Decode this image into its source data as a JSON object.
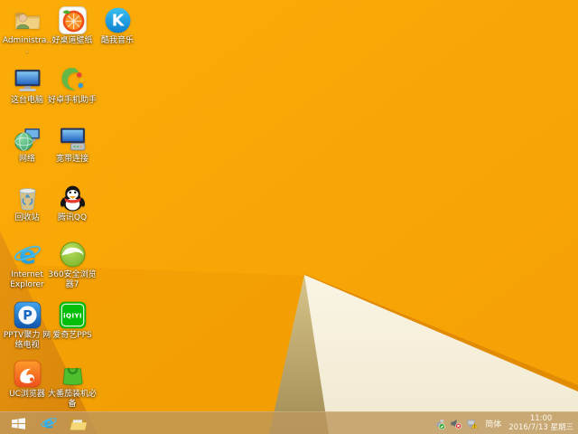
{
  "desktop": {
    "icons": [
      {
        "id": "administrator",
        "label": "Administra...",
        "icon": "user-folder-icon"
      },
      {
        "id": "haozhuodao-wallpaper",
        "label": "好桌道壁纸",
        "icon": "orange-slice-icon"
      },
      {
        "id": "kuwo-music",
        "label": "酷我音乐",
        "icon": "kuwo-k-icon",
        "glyph": "K"
      },
      {
        "id": "this-pc",
        "label": "这台电脑",
        "icon": "computer-icon"
      },
      {
        "id": "haozhuo-phone-assistant",
        "label": "好卓手机助手",
        "icon": "green-swirl-icon"
      },
      {
        "id": "network",
        "label": "网络",
        "icon": "network-globe-icon"
      },
      {
        "id": "broadband-connection",
        "label": "宽带连接",
        "icon": "broadband-icon"
      },
      {
        "id": "recycle-bin",
        "label": "回收站",
        "icon": "recycle-bin-icon"
      },
      {
        "id": "tencent-qq",
        "label": "腾讯QQ",
        "icon": "qq-penguin-icon"
      },
      {
        "id": "internet-explorer",
        "label": "Internet Explorer",
        "icon": "ie-icon",
        "glyph": "e"
      },
      {
        "id": "360-safe-browser",
        "label": "360安全浏览器7",
        "icon": "360-browser-icon"
      },
      {
        "id": "pptv",
        "label": "PPTV聚力 网络电视",
        "icon": "pptv-icon",
        "glyph": "P"
      },
      {
        "id": "iqiyi-pps",
        "label": "爱奇艺PPS",
        "icon": "iqiyi-icon",
        "glyph": "iQIYI"
      },
      {
        "id": "uc-browser",
        "label": "UC浏览器",
        "icon": "uc-squirrel-icon"
      },
      {
        "id": "big-tomato-essentials",
        "label": "大番茄装机必备",
        "icon": "green-bag-icon"
      }
    ]
  },
  "taskbar": {
    "pinned": [
      "internet-explorer",
      "file-explorer"
    ],
    "tray": {
      "icons": [
        "usb-safely-remove",
        "volume-muted",
        "network-warning"
      ],
      "input_method": "简体",
      "time": "11:00",
      "date": "2016/7/13 星期三"
    }
  },
  "colors": {
    "wallpaper_base": "#F8A608",
    "wallpaper_corner_shadow": "#DE8C0B",
    "wallpaper_fold_edge": "#E18B03",
    "facet_white": "#F7F1DF",
    "facet_beige": "#C9B778",
    "taskbar": "rgba(190,151,92,0.8)",
    "label_text": "#FFFFFF"
  }
}
